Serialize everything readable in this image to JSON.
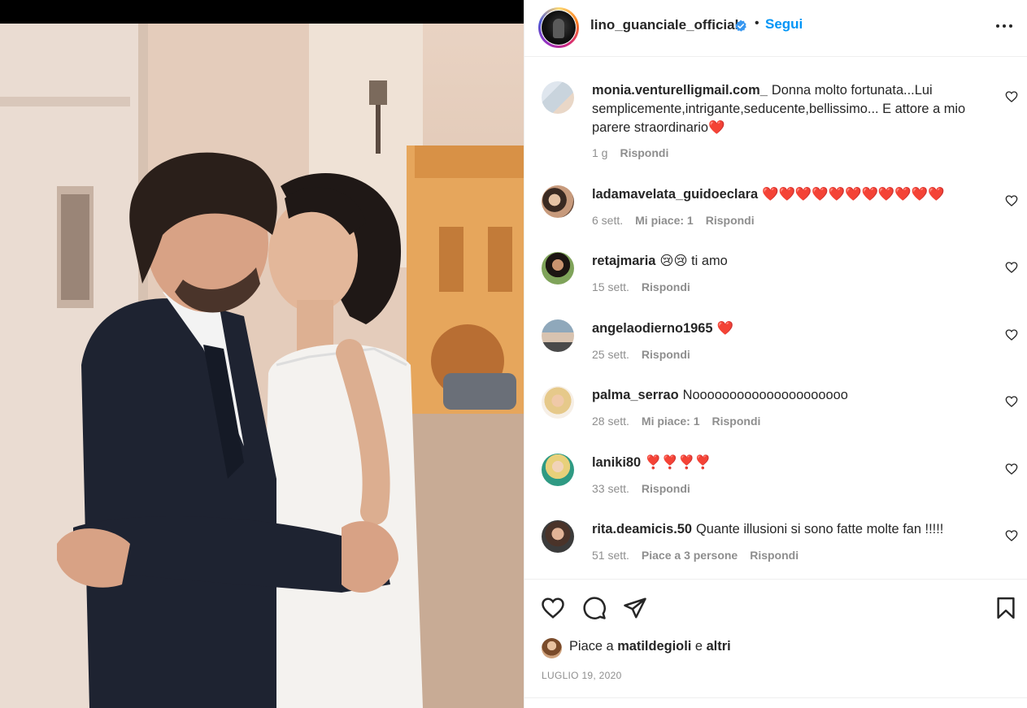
{
  "post": {
    "author": {
      "username": "lino_guanciale_official",
      "verified": true,
      "follow_label": "Segui",
      "separator": "•"
    },
    "comments": [
      {
        "username": "monia.venturelligmail.com_",
        "text": "Donna molto fortunata...Lui semplicemente,intrigante,seducente,bellissimo... E attore a mio parere straordinario❤️",
        "time": "1 g",
        "likes": "",
        "reply_label": "Rispondi"
      },
      {
        "username": "ladamavelata_guidoeclara",
        "text": "❤️❤️❤️❤️❤️❤️❤️❤️❤️❤️❤️",
        "time": "6 sett.",
        "likes": "Mi piace: 1",
        "reply_label": "Rispondi"
      },
      {
        "username": "retajmaria",
        "text": "😢😢 ti amo",
        "time": "15 sett.",
        "likes": "",
        "reply_label": "Rispondi"
      },
      {
        "username": "angelaodierno1965",
        "text": "❤️",
        "time": "25 sett.",
        "likes": "",
        "reply_label": "Rispondi"
      },
      {
        "username": "palma_serrao",
        "text": "Nooooooooooooooooooooo",
        "time": "28 sett.",
        "likes": "Mi piace: 1",
        "reply_label": "Rispondi"
      },
      {
        "username": "laniki80",
        "text": "❣️❣️❣️❣️",
        "time": "33 sett.",
        "likes": "",
        "reply_label": "Rispondi"
      },
      {
        "username": "rita.deamicis.50",
        "text": "Quante illusioni si sono fatte molte fan !!!!!",
        "time": "51 sett.",
        "likes": "Piace a 3 persone",
        "reply_label": "Rispondi"
      }
    ],
    "liked_by": {
      "prefix": "Piace a",
      "user": "matildegioli",
      "conj": "e",
      "others": "altri"
    },
    "date": "LUGLIO 19, 2020",
    "icons": {
      "like": "heart-outline-icon",
      "comment": "comment-icon",
      "share": "paper-plane-icon",
      "save": "bookmark-icon",
      "more": "more-options-icon",
      "verified": "verified-badge-icon"
    },
    "colors": {
      "accent": "#0095f6",
      "verified": "#3897f0",
      "muted": "#8e8e8e",
      "heart": "#e0202b"
    }
  }
}
